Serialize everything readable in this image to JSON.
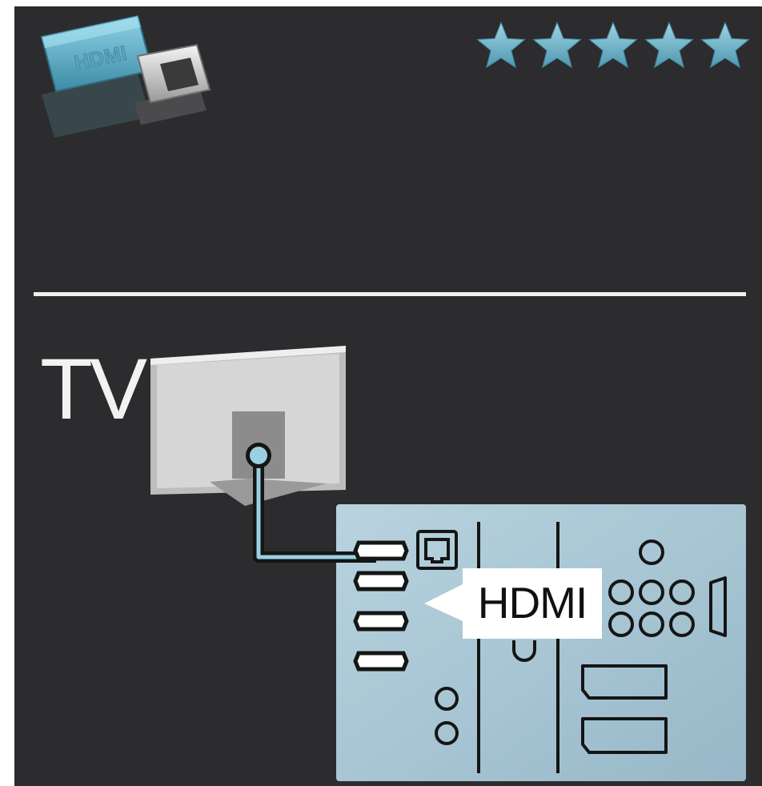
{
  "rating": {
    "stars": 5,
    "star_color": "#6eb3c9"
  },
  "device": {
    "icon": "hdmi-connector-icon",
    "plug_label": "HDMI"
  },
  "labels": {
    "tv": "TV",
    "connector": "HDMI"
  },
  "colors": {
    "background": "#2c2c2e",
    "divider": "#f1f1f1",
    "panel": "#a7c4d2",
    "tv_body": "#cfcfcf",
    "callout": "#ffffff"
  }
}
